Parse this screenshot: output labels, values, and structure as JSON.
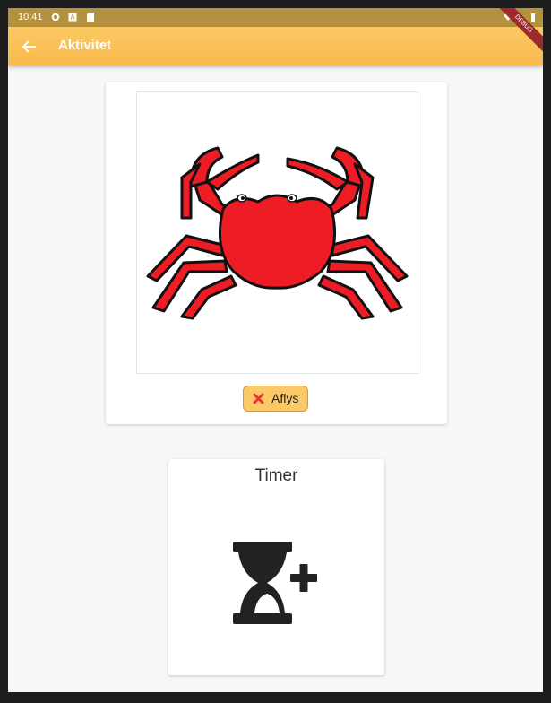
{
  "status_bar": {
    "time": "10:41"
  },
  "app_bar": {
    "title": "Aktivitet",
    "debug_label": "DEBUG"
  },
  "activity": {
    "image_icon": "crab-icon",
    "cancel_label": "Aflys"
  },
  "timer": {
    "title": "Timer",
    "icon": "hourglass-add-icon"
  },
  "colors": {
    "accent": "#f8b94e",
    "crab": "#ee1c25",
    "cancel": "#e53935"
  }
}
